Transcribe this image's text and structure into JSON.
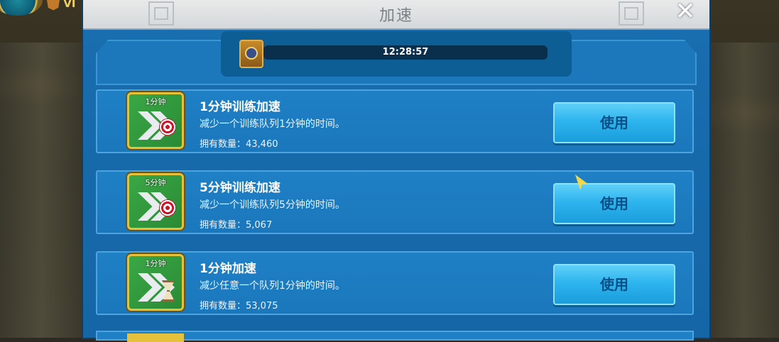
{
  "dialog": {
    "title": "加速",
    "close_icon": "close-icon",
    "timer": "12:28:57",
    "timer_icon": "building-icon"
  },
  "hud": {
    "vip": "VI"
  },
  "items": [
    {
      "icon_label": "1分钟",
      "icon_type": "training-speedup",
      "title": "1分钟训练加速",
      "desc": "减少一个训练队列1分钟的时间。",
      "count": "拥有数量：43,460",
      "button": "使用"
    },
    {
      "icon_label": "5分钟",
      "icon_type": "training-speedup",
      "title": "5分钟训练加速",
      "desc": "减少一个训练队列5分钟的时间。",
      "count": "拥有数量：5,067",
      "button": "使用"
    },
    {
      "icon_label": "1分钟",
      "icon_type": "universal-speedup",
      "title": "1分钟加速",
      "desc": "减少任意一个队列1分钟的时间。",
      "count": "拥有数量：53,075",
      "button": "使用"
    }
  ]
}
